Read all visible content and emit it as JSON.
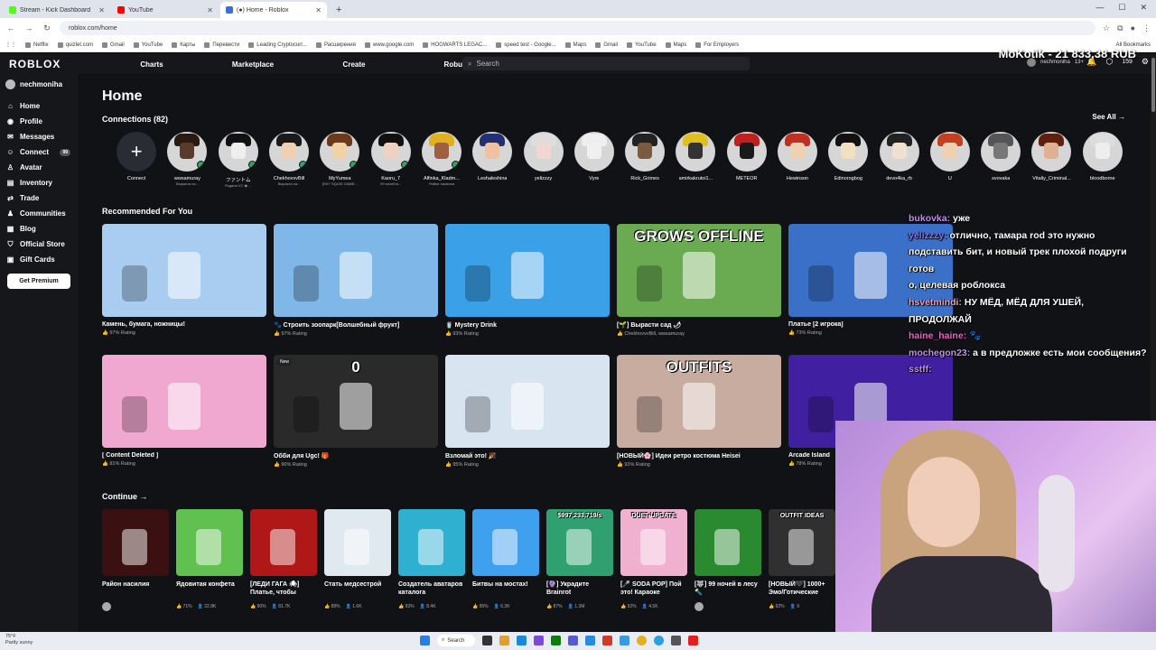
{
  "browser": {
    "tabs": [
      {
        "title": "Stream - Kick Dashboard",
        "color": "#53fc18"
      },
      {
        "title": "YouTube",
        "color": "#ff0000"
      },
      {
        "title": "(●) Home - Roblox",
        "color": "#3b6fd8",
        "active": true
      }
    ],
    "url": "roblox.com/home",
    "bookmarks": [
      "Netflix",
      "quizlet.com",
      "Gmail",
      "YouTube",
      "Карты",
      "Перевести",
      "Leading Cryptocurr...",
      "Расширения",
      "www.google.com",
      "HOGWARTS LEGAC...",
      "speed test - Google...",
      "Maps",
      "Gmail",
      "YouTube",
      "Maps",
      "For Employers"
    ],
    "all_bookmarks": "All Bookmarks"
  },
  "roblox": {
    "logo": "ROBLOX",
    "nav": [
      "Charts",
      "Marketplace",
      "Create",
      "Robux"
    ],
    "search_placeholder": "Search",
    "username_top": "nechmoniha",
    "age_tag": "13+",
    "robux": "159",
    "sidebar_user": "nechmoniha",
    "sidebar": [
      {
        "label": "Home",
        "icon": "⌂"
      },
      {
        "label": "Profile",
        "icon": "◉"
      },
      {
        "label": "Messages",
        "icon": "✉"
      },
      {
        "label": "Connect",
        "icon": "☺",
        "badge": "99"
      },
      {
        "label": "Avatar",
        "icon": "♙"
      },
      {
        "label": "Inventory",
        "icon": "▤"
      },
      {
        "label": "Trade",
        "icon": "⇄"
      },
      {
        "label": "Communities",
        "icon": "♟"
      },
      {
        "label": "Blog",
        "icon": "▦"
      },
      {
        "label": "Official Store",
        "icon": "⛉"
      },
      {
        "label": "Gift Cards",
        "icon": "▣"
      }
    ],
    "premium_button": "Get Premium",
    "page_title": "Home",
    "connections_title": "Connections (82)",
    "see_all": "See All →",
    "connect_label": "Connect",
    "connections": [
      {
        "name": "wwsamuray",
        "sub": "Вырасти са...",
        "hair": "#2a1a10",
        "skin": "#5a3a2a"
      },
      {
        "name": "ファントム",
        "sub": "Родина VC ◉ ...",
        "hair": "#111111",
        "skin": "#eeeeee"
      },
      {
        "name": "ChekhovvvBill",
        "sub": "Вырасти са...",
        "hair": "#1a1a1a",
        "skin": "#f0d0b0"
      },
      {
        "name": "MyYumea",
        "sub": "[SKY SQUID GAME...",
        "hair": "#6b3a1a",
        "skin": "#f2d2a2"
      },
      {
        "name": "Kaoru_7",
        "sub": "99 ночей в...",
        "hair": "#111111",
        "skin": "#f0d0c0"
      },
      {
        "name": "Alfinka_Kladm...",
        "sub": "Район насилия",
        "hair": "#e0b020",
        "skin": "#a06040"
      },
      {
        "name": "Leshaleshina",
        "sub": "",
        "hair": "#203070",
        "skin": "#f0c0a0"
      },
      {
        "name": "yelizzzy",
        "sub": "",
        "hair": "#dddddd",
        "skin": "#f0d8d0"
      },
      {
        "name": "Vyre",
        "sub": "",
        "hair": "#eeeeee",
        "skin": "#f0f0f0"
      },
      {
        "name": "Rick_Grimes",
        "sub": "",
        "hair": "#222222",
        "skin": "#7a5a40"
      },
      {
        "name": "amirkakrutoi1...",
        "sub": "",
        "hair": "#e0c020",
        "skin": "#333333"
      },
      {
        "name": "METEOR",
        "sub": "",
        "hair": "#c02020",
        "skin": "#1a1a1a"
      },
      {
        "name": "Hewinson",
        "sub": "",
        "hair": "#c03020",
        "skin": "#f0d0b0"
      },
      {
        "name": "Edinorogbog",
        "sub": "",
        "hair": "#111111",
        "skin": "#f2e0c0"
      },
      {
        "name": "devo4ka_rb",
        "sub": "",
        "hair": "#222222",
        "skin": "#f0e0d0"
      },
      {
        "name": "U",
        "sub": "",
        "hair": "#c04020",
        "skin": "#f0d0b0"
      },
      {
        "name": "svovaka",
        "sub": "",
        "hair": "#555555",
        "skin": "#777777"
      },
      {
        "name": "Vitaliy_Criminal...",
        "sub": "",
        "hair": "#602010",
        "skin": "#e0b090"
      },
      {
        "name": "bloodborne",
        "sub": "",
        "hair": "#dddddd",
        "skin": "#eeeeee"
      }
    ],
    "recommended_title": "Recommended For You",
    "recommended_row1": [
      {
        "title": "Камень, бумага, ножницы!",
        "rating": "97% Rating",
        "bg": "#a9cdf0",
        "overlay": ""
      },
      {
        "title": "🐾 Строить зоопарк[Волшебный фрукт]",
        "rating": "97% Rating",
        "bg": "#7fb8e8",
        "overlay": ""
      },
      {
        "title": "🥤 Mystery Drink",
        "rating": "93% Rating",
        "bg": "#3aa0e8",
        "overlay": ""
      },
      {
        "title": "[🌱] Вырасти сад 🌶",
        "rating": "ChekhovvvBill, wwsamuray",
        "bg": "#6aaa50",
        "overlay": "GROWS OFFLINE"
      },
      {
        "title": "Платье [2 игрока]",
        "rating": "73% Rating",
        "bg": "#3a70c8",
        "overlay": ""
      }
    ],
    "recommended_row2": [
      {
        "title": "[ Content Deleted ]",
        "rating": "81% Rating",
        "bg": "#f0a8d0",
        "overlay": "",
        "new": ""
      },
      {
        "title": "Обби для Ugc! 🎁",
        "rating": "90% Rating",
        "bg": "#2a2a2a",
        "overlay": "0",
        "new": "New"
      },
      {
        "title": "Взломай это! 🎉",
        "rating": "95% Rating",
        "bg": "#d8e4f0",
        "overlay": "",
        "new": ""
      },
      {
        "title": "[НОВЫЙ🌸] Идеи ретро костюма Heisei",
        "rating": "92% Rating",
        "bg": "#c8aca0",
        "overlay": "OUTFITS",
        "new": ""
      },
      {
        "title": "Arcade Island",
        "rating": "78% Rating",
        "bg": "#4020a0",
        "overlay": "",
        "new": ""
      }
    ],
    "continue_title": "Continue →",
    "continue": [
      {
        "title": "Район насилия",
        "stats": [
          "",
          ""
        ],
        "bg": "#3a1010",
        "overlay": ""
      },
      {
        "title": "Ядовитая конфета",
        "stats": [
          "71%",
          "22.8K"
        ],
        "bg": "#60c050",
        "overlay": ""
      },
      {
        "title": "[ЛЕДИ ГАГА 🕷] Платье, чтобы",
        "stats": [
          "90%",
          "81.7K"
        ],
        "bg": "#b01818",
        "overlay": ""
      },
      {
        "title": "Стать медсестрой",
        "stats": [
          "88%",
          "1.6K"
        ],
        "bg": "#e0e8f0",
        "overlay": ""
      },
      {
        "title": "Создатель аватаров каталога",
        "stats": [
          "93%",
          "8.4K"
        ],
        "bg": "#30b0d0",
        "overlay": ""
      },
      {
        "title": "Битвы на мостах!",
        "stats": [
          "95%",
          "6.3K"
        ],
        "bg": "#40a0f0",
        "overlay": ""
      },
      {
        "title": "[🔮] Украдите Brainrot",
        "stats": [
          "87%",
          "1.3M"
        ],
        "bg": "#30a070",
        "overlay": "$997,233,719/s"
      },
      {
        "title": "[🎤 SODA POP] Пой это! Караоке",
        "stats": [
          "92%",
          "4.5K"
        ],
        "bg": "#f0b0d0",
        "overlay": "DUET UPDATE"
      },
      {
        "title": "[🐺] 99 ночей в лесу 🔦",
        "stats": [
          "",
          ""
        ],
        "bg": "#2a8a30",
        "overlay": ""
      },
      {
        "title": "[НОВЫЙ🖤] 1000+ Эмо/Готические",
        "stats": [
          "92%",
          "9"
        ],
        "bg": "#303030",
        "overlay": "OUTFIT IDEAS"
      }
    ]
  },
  "stream": {
    "donation": "MoKotik - 21 833,38 RUB",
    "chat": [
      {
        "user": "bukovka",
        "text": " уже"
      },
      {
        "user": "yelizzzy",
        "text": " отлично, тамара rod это нужно подставить бит, и новый трек плохой подруги готов"
      },
      {
        "user": "",
        "text": " о, целевая роблокса"
      },
      {
        "user": "hsvetmindi",
        "text": " НУ МЁД, МЁД ДЛЯ УШЕЙ, ПРОДОЛЖАЙ"
      },
      {
        "user": "haine_haine",
        "text": " 🐾"
      },
      {
        "user": "mochegon23",
        "text": " а в предложке есть мои сообщения?"
      },
      {
        "user": "sstff",
        "text": ""
      }
    ]
  },
  "taskbar": {
    "temp": "75°F",
    "weather": "Partly sunny",
    "search": "Search"
  }
}
